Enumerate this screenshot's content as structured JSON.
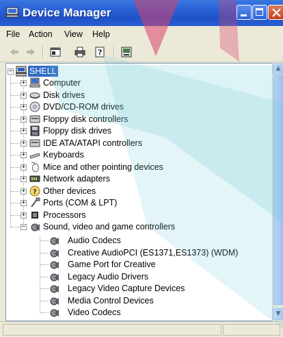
{
  "window": {
    "title": "Device Manager"
  },
  "menu": {
    "items": [
      "File",
      "Action",
      "View",
      "Help"
    ]
  },
  "toolbar": {
    "icons": [
      "back-icon",
      "forward-icon",
      "properties-icon",
      "print-icon",
      "help-icon",
      "scan-hardware-icon"
    ]
  },
  "tree": {
    "root_label": "SHELL",
    "categories": [
      {
        "label": "Computer",
        "icon": "computer-icon"
      },
      {
        "label": "Disk drives",
        "icon": "disk-drive-icon"
      },
      {
        "label": "DVD/CD-ROM drives",
        "icon": "cdrom-icon"
      },
      {
        "label": "Floppy disk controllers",
        "icon": "floppy-controller-icon"
      },
      {
        "label": "Floppy disk drives",
        "icon": "floppy-drive-icon"
      },
      {
        "label": "IDE ATA/ATAPI controllers",
        "icon": "ide-controller-icon"
      },
      {
        "label": "Keyboards",
        "icon": "keyboard-icon"
      },
      {
        "label": "Mice and other pointing devices",
        "icon": "mouse-icon"
      },
      {
        "label": "Network adapters",
        "icon": "network-adapter-icon"
      },
      {
        "label": "Other devices",
        "icon": "unknown-device-icon"
      },
      {
        "label": "Ports (COM & LPT)",
        "icon": "port-icon"
      },
      {
        "label": "Processors",
        "icon": "processor-icon"
      },
      {
        "label": "Sound, video and game controllers",
        "icon": "sound-icon"
      }
    ],
    "sound_children": [
      "Audio Codecs",
      "Creative AudioPCI (ES1371,ES1373) (WDM)",
      "Game Port for Creative",
      "Legacy Audio Drivers",
      "Legacy Video Capture Devices",
      "Media Control Devices",
      "Video Codecs"
    ]
  },
  "colors": {
    "titlebar": "#2a62d6",
    "selection": "#316ac5",
    "overlay_pink": "#d9426a",
    "overlay_cyan": "#69c9d8"
  }
}
